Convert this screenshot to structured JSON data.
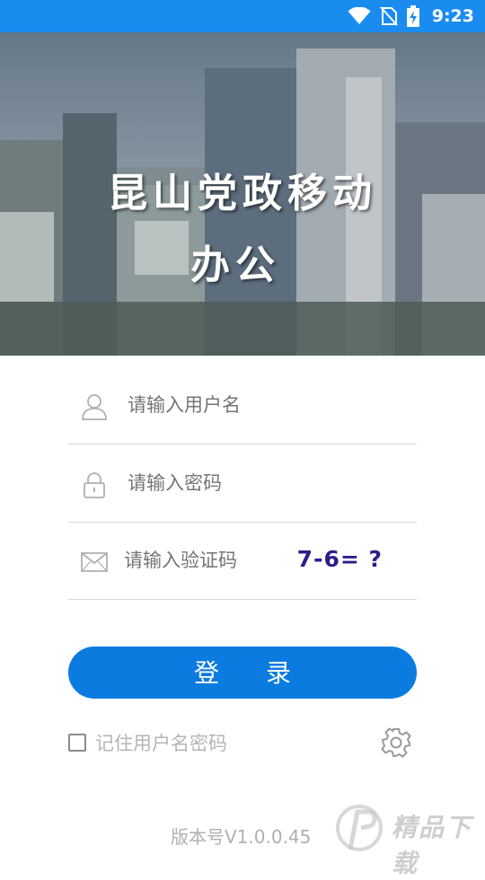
{
  "status_bar": {
    "time": "9:23",
    "icons": [
      "wifi-icon",
      "no-sim-icon",
      "battery-charging-icon"
    ]
  },
  "hero": {
    "title_line1": "昆山党政移动",
    "title_line2": "办公"
  },
  "form": {
    "username_placeholder": "请输入用户名",
    "password_placeholder": "请输入密码",
    "captcha_placeholder": "请输入验证码",
    "captcha_question": "7-6= ?"
  },
  "login_button": "登录",
  "remember_label": "记住用户名密码",
  "remember_checked": false,
  "version": "版本号V1.0.0.45",
  "watermark": "精品下载",
  "colors": {
    "status_bar": "#1a8cf0",
    "primary": "#0b7be0",
    "captcha": "#2b1f8a"
  }
}
